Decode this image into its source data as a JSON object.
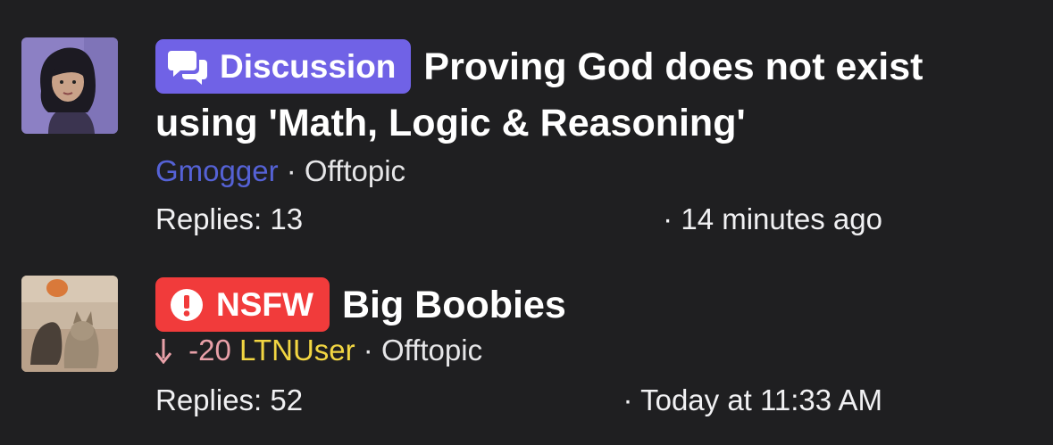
{
  "threads": [
    {
      "badge": {
        "label": "Discussion",
        "icon": "speech-bubbles-icon",
        "color": "#7062e6"
      },
      "title": "Proving God does not exist using 'Math, Logic & Reasoning'",
      "author": "Gmogger",
      "author_color": "#5562d6",
      "forum": "Offtopic",
      "votes": null,
      "replies": "Replies: 13",
      "time": "14 minutes ago"
    },
    {
      "badge": {
        "label": "NSFW",
        "icon": "exclamation-circle-icon",
        "color": "#f13b3b"
      },
      "title": "Big Boobies",
      "author": "LTNUser",
      "author_color": "#f2d642",
      "forum": "Offtopic",
      "votes": "-20",
      "vote_icon": "arrow-down-icon",
      "replies": "Replies: 52",
      "time": "Today at 11:33 AM"
    }
  ],
  "separator": "·"
}
